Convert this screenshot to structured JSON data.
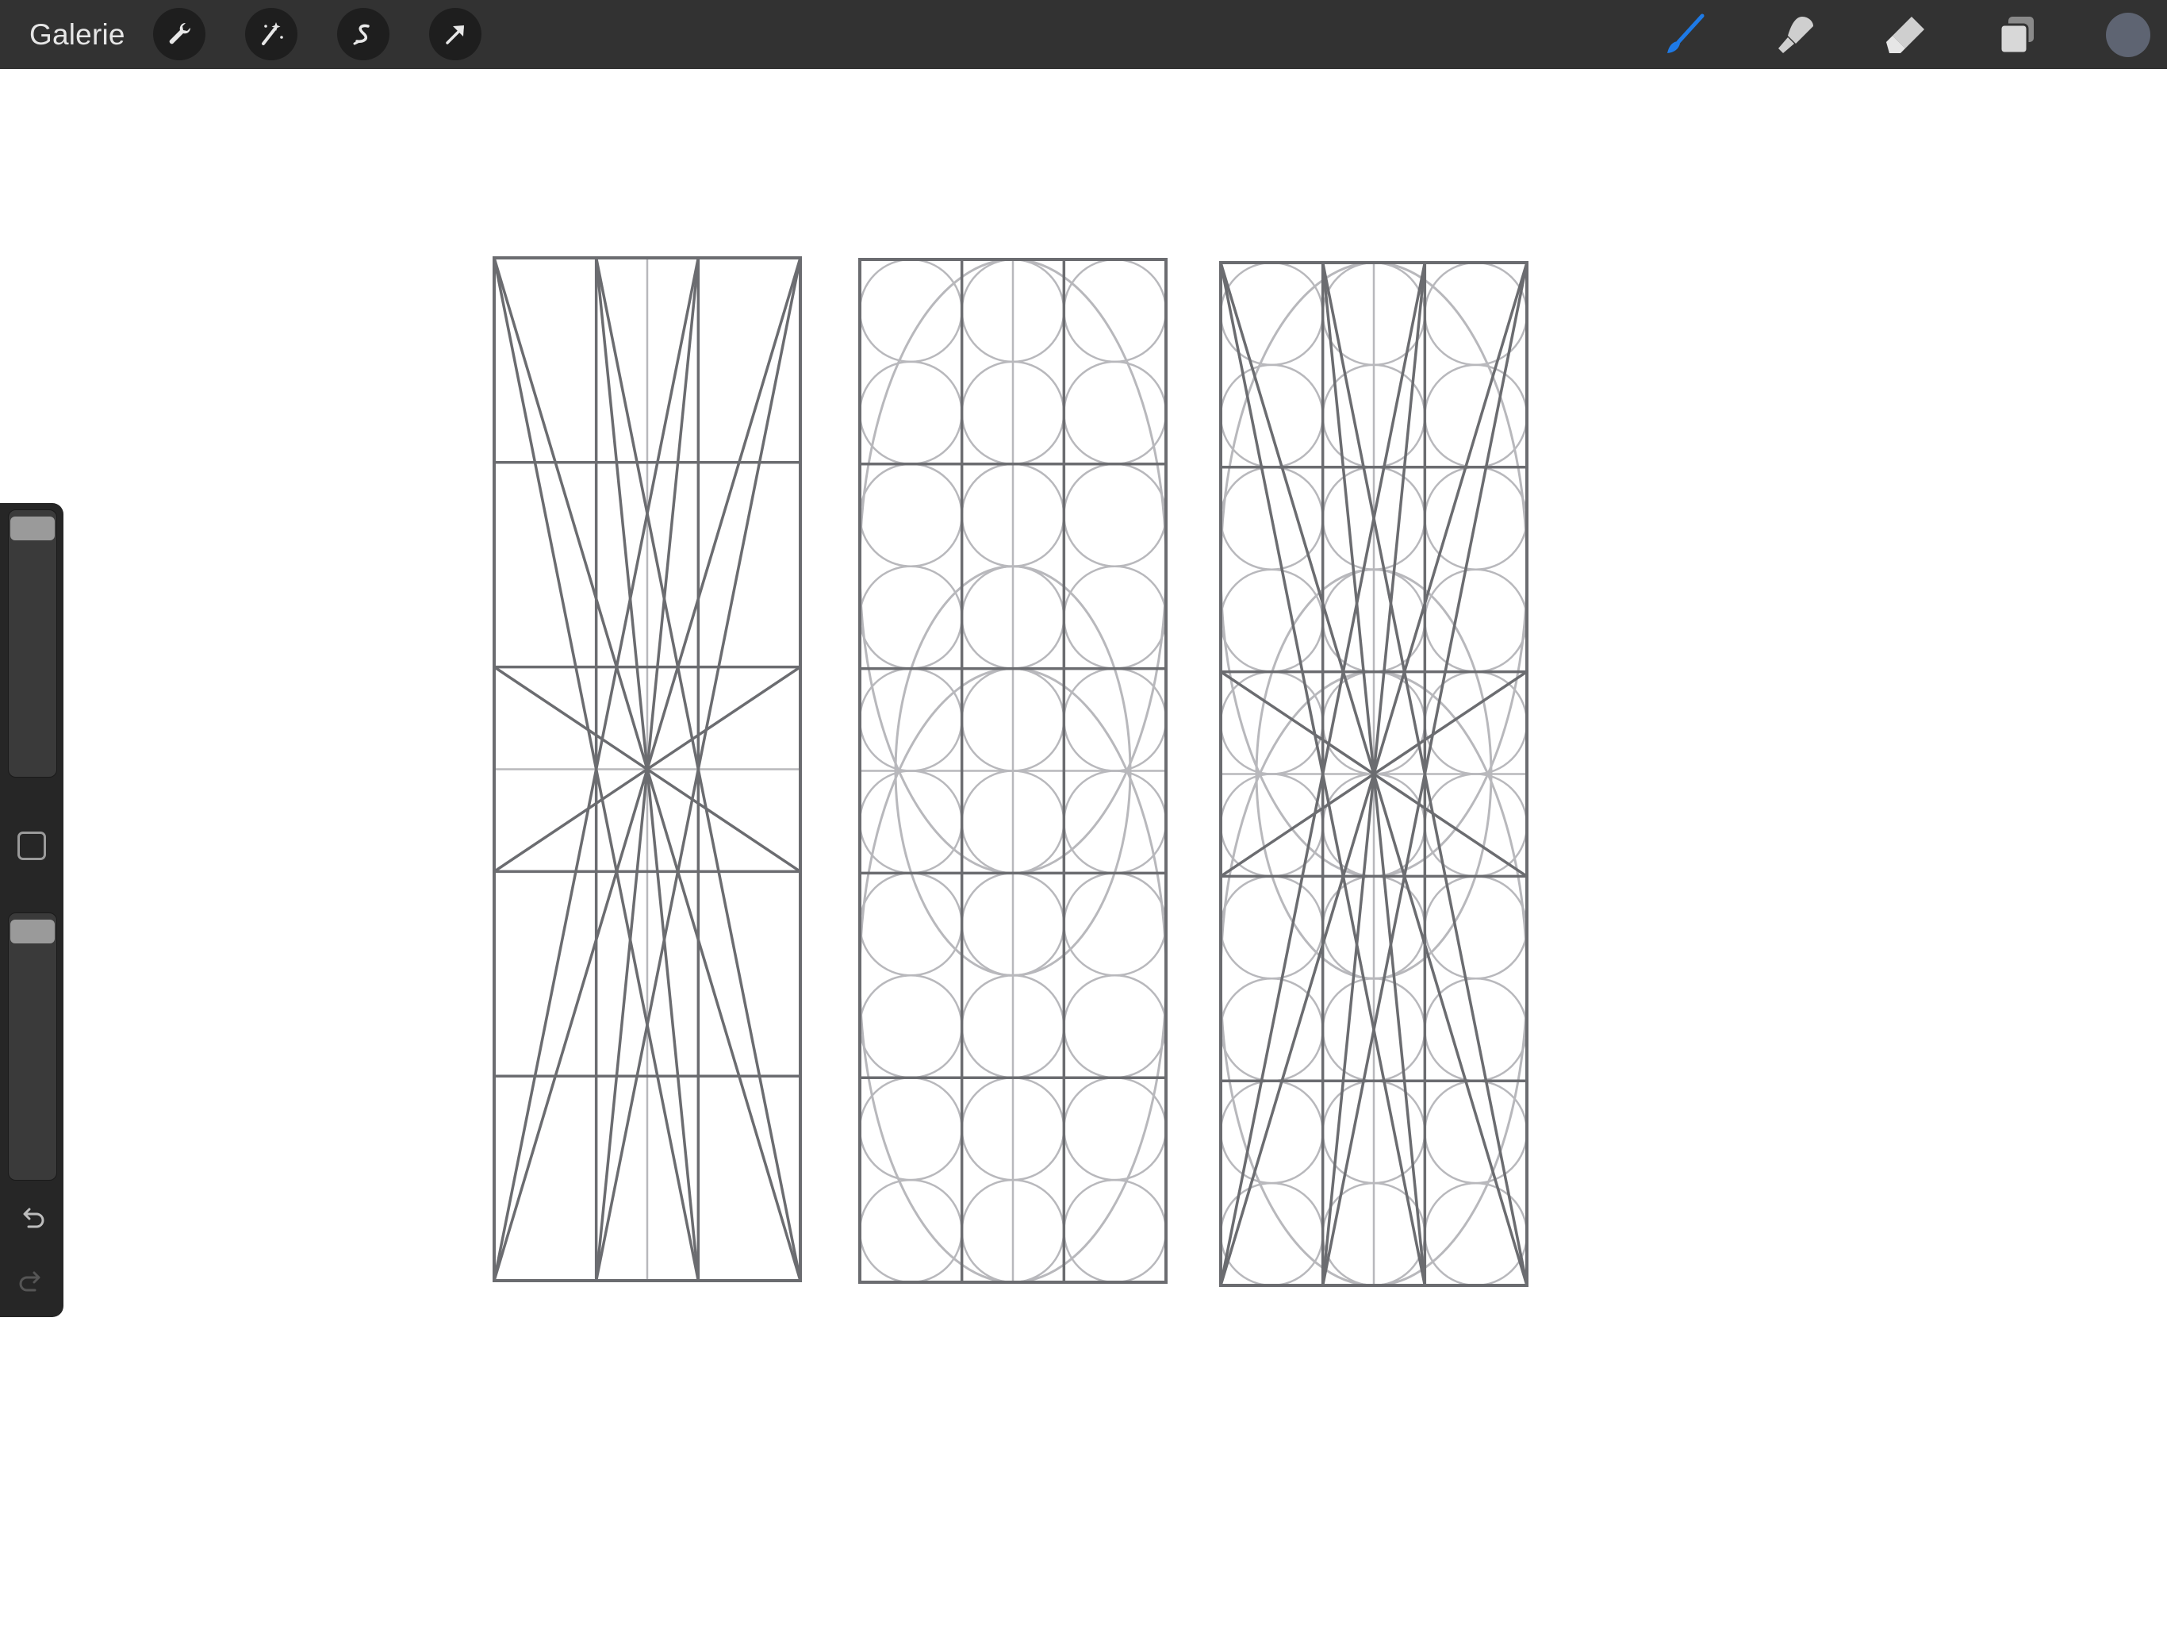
{
  "topbar": {
    "gallery_label": "Galerie",
    "left_tools": [
      "wrench-icon",
      "magic-wand-icon",
      "selection-icon",
      "transform-arrow-icon"
    ],
    "right_tools": [
      "brush-icon",
      "smudge-icon",
      "eraser-icon",
      "layers-icon"
    ],
    "active_tool": "brush-icon",
    "active_color": "#1e7ae6",
    "current_color": "#5e6472"
  },
  "sidebar": {
    "brush_size_level": 0.02,
    "opacity_level": 0.02,
    "icons": [
      "modifier-square-icon",
      "undo-icon",
      "redo-icon"
    ]
  },
  "drawing": {
    "stroke_dark": "#6b6c70",
    "stroke_light": "#b8b8bc",
    "panels": [
      "diagonal-grid",
      "circle-grid",
      "combined-grid"
    ]
  }
}
